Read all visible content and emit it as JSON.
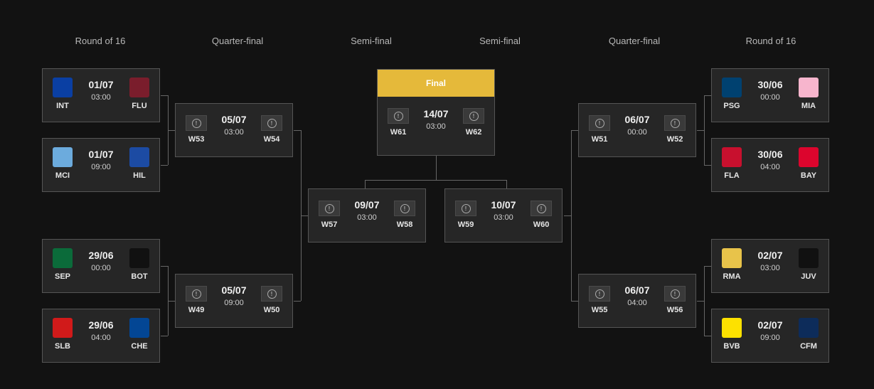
{
  "columns": [
    "Round of 16",
    "Quarter-final",
    "Semi-final",
    "Semi-final",
    "Quarter-final",
    "Round of 16"
  ],
  "r16_left": [
    {
      "home": "INT",
      "away": "FLU",
      "date": "01/07",
      "time": "03:00",
      "home_color": "#0a3fa3",
      "away_color": "#7a1d2c"
    },
    {
      "home": "MCI",
      "away": "HIL",
      "date": "01/07",
      "time": "09:00",
      "home_color": "#6cabdd",
      "away_color": "#1c4ba3"
    },
    {
      "home": "SEP",
      "away": "BOT",
      "date": "29/06",
      "time": "00:00",
      "home_color": "#0b6b3a",
      "away_color": "#111111"
    },
    {
      "home": "SLB",
      "away": "CHE",
      "date": "29/06",
      "time": "04:00",
      "home_color": "#d11a1a",
      "away_color": "#034694"
    }
  ],
  "qf_left": [
    {
      "home": "W53",
      "away": "W54",
      "date": "05/07",
      "time": "03:00"
    },
    {
      "home": "W49",
      "away": "W50",
      "date": "05/07",
      "time": "09:00"
    }
  ],
  "sf_left": {
    "home": "W57",
    "away": "W58",
    "date": "09/07",
    "time": "03:00"
  },
  "final": {
    "label": "Final",
    "home": "W61",
    "away": "W62",
    "date": "14/07",
    "time": "03:00"
  },
  "sf_right": {
    "home": "W59",
    "away": "W60",
    "date": "10/07",
    "time": "03:00"
  },
  "qf_right": [
    {
      "home": "W51",
      "away": "W52",
      "date": "06/07",
      "time": "00:00"
    },
    {
      "home": "W55",
      "away": "W56",
      "date": "06/07",
      "time": "04:00"
    }
  ],
  "r16_right": [
    {
      "home": "PSG",
      "away": "MIA",
      "date": "30/06",
      "time": "00:00",
      "home_color": "#004170",
      "away_color": "#f7b5cd"
    },
    {
      "home": "FLA",
      "away": "BAY",
      "date": "30/06",
      "time": "04:00",
      "home_color": "#c8102e",
      "away_color": "#dc052d"
    },
    {
      "home": "RMA",
      "away": "JUV",
      "date": "02/07",
      "time": "03:00",
      "home_color": "#e8c34a",
      "away_color": "#111111"
    },
    {
      "home": "BVB",
      "away": "CFM",
      "date": "02/07",
      "time": "09:00",
      "home_color": "#fde100",
      "away_color": "#0d2c5a"
    }
  ],
  "icons": {
    "tbd": "alert-circle-icon"
  }
}
